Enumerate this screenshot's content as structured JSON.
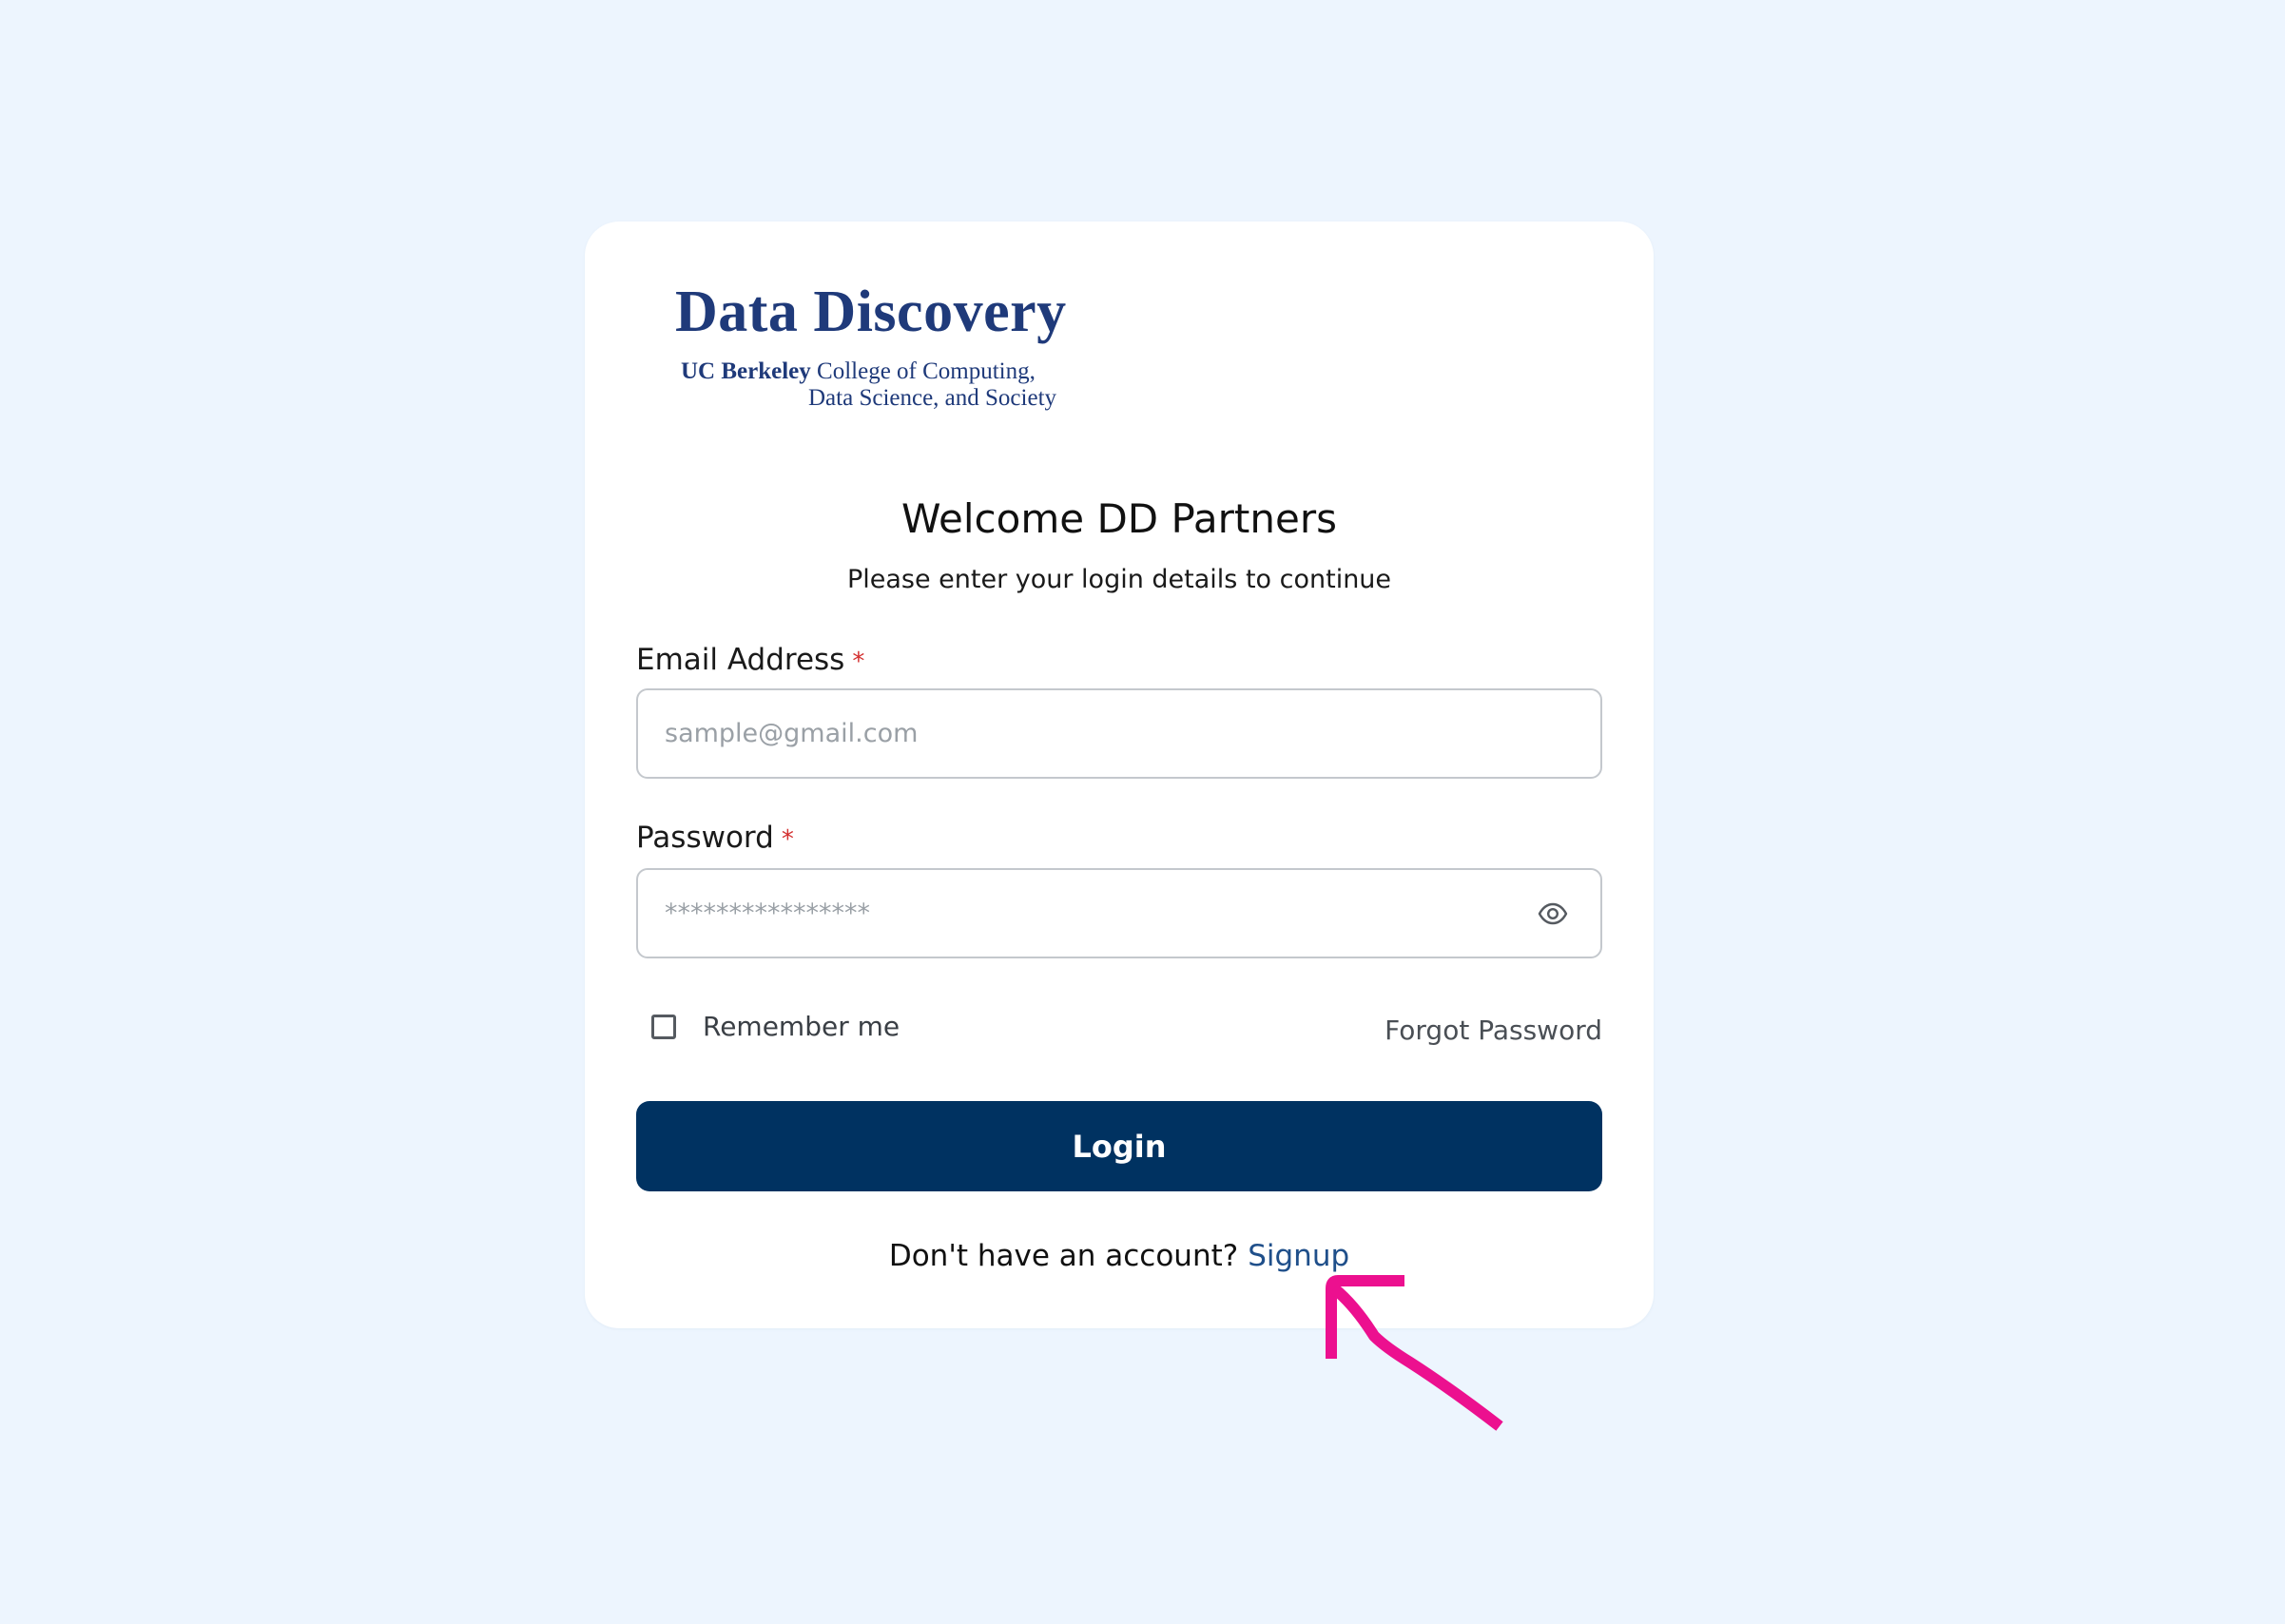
{
  "logo": {
    "title": "Data Discovery",
    "sub_bold": "UC Berkeley",
    "sub_line1_rest": " College of Computing,",
    "sub_line2": "Data Science, and Society"
  },
  "header": {
    "title": "Welcome DD Partners",
    "subtitle": "Please enter your login details to continue"
  },
  "form": {
    "email_label": "Email Address",
    "email_placeholder": "sample@gmail.com",
    "password_label": "Password",
    "password_placeholder": "****************",
    "required_marker": "*",
    "remember_label": "Remember me",
    "forgot_label": "Forgot Password",
    "login_label": "Login"
  },
  "signup": {
    "prompt": "Don't have an account?",
    "link": "Signup"
  },
  "colors": {
    "background": "#edf5fe",
    "primary": "#003261",
    "required": "#d32f2f",
    "annotation": "#ec108f"
  }
}
